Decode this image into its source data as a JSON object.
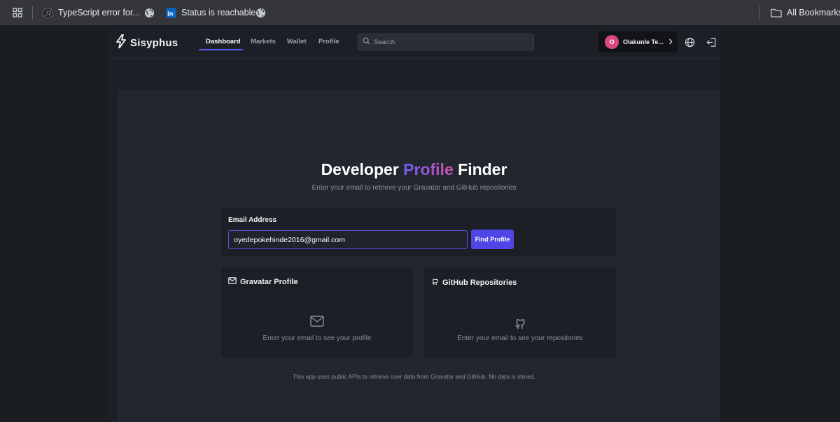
{
  "bookmarks_bar": {
    "items": [
      {
        "label": "TypeScript error for...",
        "icon": "github-icon"
      },
      {
        "label": "",
        "icon": "globe-icon"
      },
      {
        "label": "Status is reachable",
        "icon": "linkedin-icon"
      },
      {
        "label": "",
        "icon": "globe-icon"
      }
    ],
    "all_bookmarks": "All Bookmarks"
  },
  "nav": {
    "brand": "Sisyphus",
    "links": [
      "Dashboard",
      "Markets",
      "Wallet",
      "Profile"
    ],
    "active_link": "Dashboard",
    "search_placeholder": "Search",
    "user": {
      "initial": "O",
      "name": "Olakunle Te..."
    }
  },
  "hero": {
    "title_before": "Developer ",
    "title_highlight": "Profile",
    "title_after": " Finder",
    "subtitle": "Enter your email to retrieve your Gravatar and GitHub repositories"
  },
  "form": {
    "label": "Email Address",
    "email_value": "oyedepokehinde2016@gmail.com",
    "button": "Find Profile"
  },
  "cards": [
    {
      "title": "Gravatar Profile",
      "icon": "mail-icon",
      "empty_text": "Enter your email to see your profile"
    },
    {
      "title": "GitHub Repositories",
      "icon": "github-icon",
      "empty_text": "Enter your email to see your repositories"
    }
  ],
  "footer": "This app uses public APIs to retrieve user data from Gravatar and GitHub. No data is stored.",
  "colors": {
    "accent": "#4f46e5",
    "gradient_start": "#6d5cf6",
    "gradient_end": "#d64fa6",
    "avatar": "#d9497e"
  }
}
